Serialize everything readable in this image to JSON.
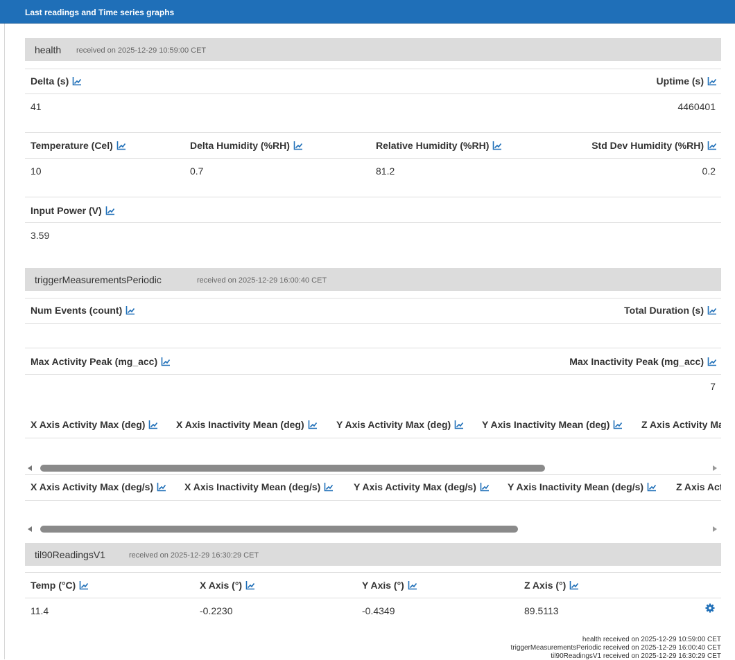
{
  "header": {
    "title": "Last readings and Time series graphs"
  },
  "colors": {
    "accent": "#1f6fb8",
    "section_bg": "#dcdcdc"
  },
  "health": {
    "name": "health",
    "received": "received on 2025-12-29 10:59:00 CET",
    "delta": {
      "label": "Delta (s)",
      "value": "41"
    },
    "uptime": {
      "label": "Uptime (s)",
      "value": "4460401"
    },
    "temperature": {
      "label": "Temperature (Cel)",
      "value": "10"
    },
    "delta_humidity": {
      "label": "Delta Humidity (%RH)",
      "value": "0.7"
    },
    "relative_humidity": {
      "label": "Relative Humidity (%RH)",
      "value": "81.2"
    },
    "std_dev_humidity": {
      "label": "Std Dev Humidity (%RH)",
      "value": "0.2"
    },
    "input_power": {
      "label": "Input Power (V)",
      "value": "3.59"
    }
  },
  "trigger": {
    "name": "triggerMeasurementsPeriodic",
    "received": "received on 2025-12-29 16:00:40 CET",
    "num_events": {
      "label": "Num Events (count)"
    },
    "total_duration": {
      "label": "Total Duration (s)"
    },
    "max_activity_peak": {
      "label": "Max Activity Peak (mg_acc)"
    },
    "max_inactivity_peak": {
      "label": "Max Inactivity Peak (mg_acc)",
      "value": "7"
    },
    "deg_row": [
      "X Axis Activity Max (deg)",
      "X Axis Inactivity Mean (deg)",
      "Y Axis Activity Max (deg)",
      "Y Axis Inactivity Mean (deg)",
      "Z Axis Activity Max (deg)"
    ],
    "degs_row": [
      "X Axis Activity Max (deg/s)",
      "X Axis Inactivity Mean (deg/s)",
      "Y Axis Activity Max (deg/s)",
      "Y Axis Inactivity Mean (deg/s)",
      "Z Axis Activity Max (deg/s)"
    ],
    "scroll1_fraction": 0.75,
    "scroll2_fraction": 0.71
  },
  "til90": {
    "name": "til90ReadingsV1",
    "received": "received on 2025-12-29 16:30:29 CET",
    "temp": {
      "label": "Temp (°C)",
      "value": "11.4"
    },
    "x_axis": {
      "label": "X Axis (°)",
      "value": "-0.2230"
    },
    "y_axis": {
      "label": "Y Axis (°)",
      "value": "-0.4349"
    },
    "z_axis": {
      "label": "Z Axis (°)",
      "value": "89.5113"
    }
  },
  "footer": {
    "lines": [
      "health received on 2025-12-29 10:59:00 CET",
      "triggerMeasurementsPeriodic received on 2025-12-29 16:00:40 CET",
      "til90ReadingsV1 received on 2025-12-29 16:30:29 CET"
    ]
  }
}
